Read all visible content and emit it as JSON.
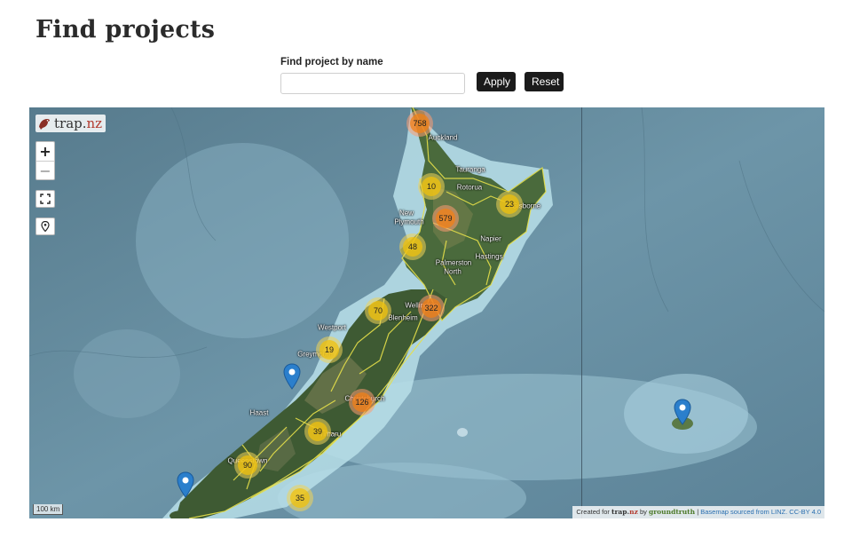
{
  "page": {
    "title": "Find projects"
  },
  "search": {
    "label": "Find project by name",
    "value": "",
    "placeholder": "",
    "apply_label": "Apply",
    "reset_label": "Reset"
  },
  "map": {
    "logo": {
      "brand": "trap.",
      "suffix": "nz"
    },
    "controls": {
      "zoom_in": "+",
      "zoom_out": "−",
      "fullscreen_icon": "fullscreen-icon",
      "locate_icon": "location-pin-icon"
    },
    "clusters": [
      {
        "count": "758",
        "level": "medium"
      },
      {
        "count": "10",
        "level": "small"
      },
      {
        "count": "579",
        "level": "medium"
      },
      {
        "count": "23",
        "level": "small"
      },
      {
        "count": "48",
        "level": "small"
      },
      {
        "count": "322",
        "level": "medium"
      },
      {
        "count": "70",
        "level": "small"
      },
      {
        "count": "19",
        "level": "small"
      },
      {
        "count": "126",
        "level": "medium"
      },
      {
        "count": "39",
        "level": "small"
      },
      {
        "count": "90",
        "level": "small"
      },
      {
        "count": "35",
        "level": "small"
      }
    ],
    "place_labels": [
      "Auckland",
      "Tauranga",
      "Rotorua",
      "Gisborne",
      "New",
      "Plymouth",
      "Napier",
      "Hastings",
      "Palmerston",
      "North",
      "Wellington",
      "Blenheim",
      "Westport",
      "Greymouth",
      "Christchurch",
      "Haast",
      "Timaru",
      "Queenstown"
    ],
    "scale": "100 km",
    "attribution": {
      "prefix": "Created for",
      "brand": "trap.",
      "brand_suffix": "nz",
      "by": "by",
      "partner": "groundtruth",
      "sep": "|",
      "basemap": "Basemap sourced from LINZ. CC-BY 4.0"
    },
    "colors": {
      "ocean_deep": "#4f7688",
      "ocean_shallow": "#9ec8d8",
      "land": "#3f5a34",
      "region_border": "#e6e04a",
      "cluster_small": "#f0c20c",
      "cluster_medium": "#f18017",
      "pin": "#2b7fcc"
    }
  }
}
